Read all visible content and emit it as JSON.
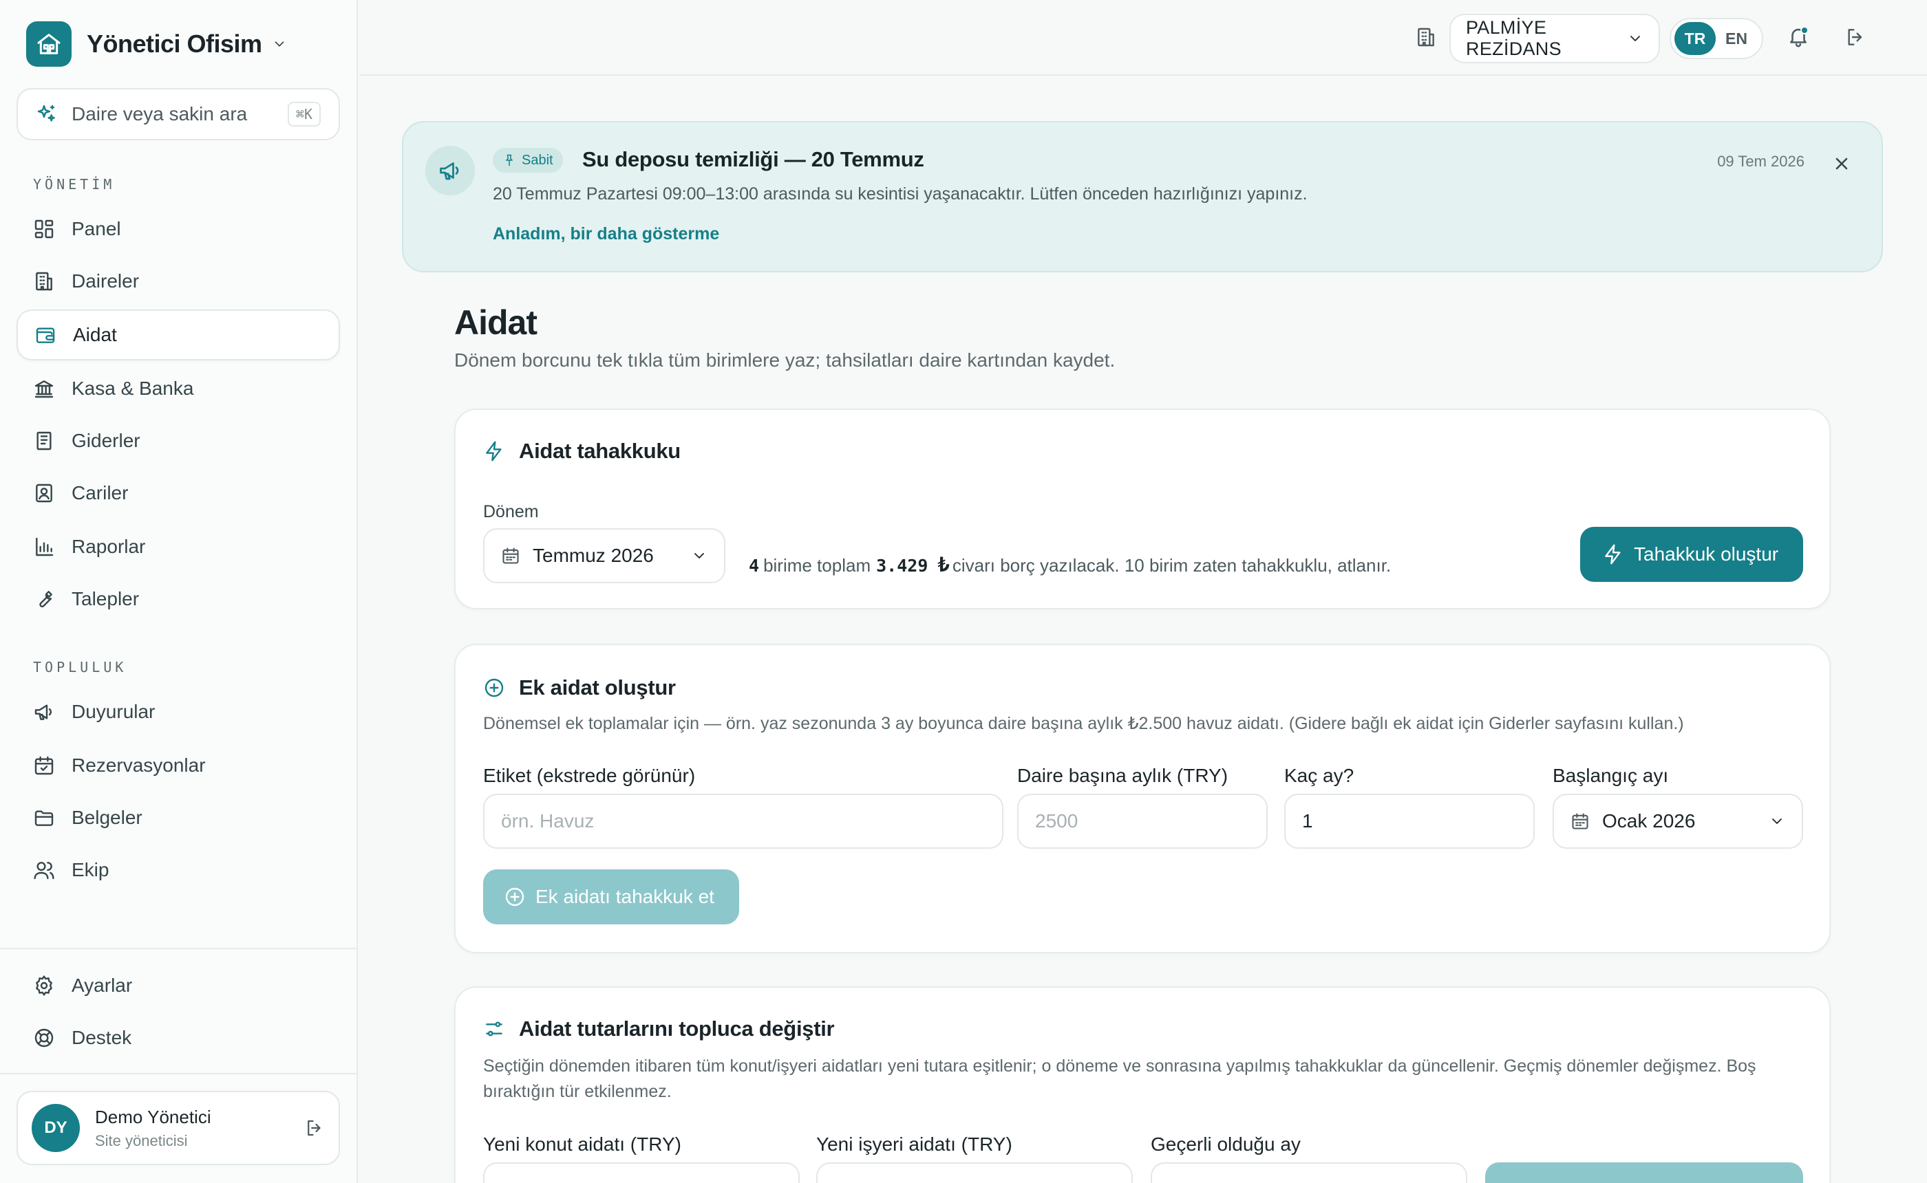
{
  "brand": {
    "name": "Yönetici Ofisim"
  },
  "search": {
    "placeholder": "Daire veya sakin ara",
    "shortcut": "⌘K"
  },
  "sidebar": {
    "group_management": "YÖNETİM",
    "group_community": "TOPLULUK",
    "items": [
      {
        "label": "Panel",
        "icon": "grid-icon"
      },
      {
        "label": "Daireler",
        "icon": "building-icon"
      },
      {
        "label": "Aidat",
        "icon": "wallet-icon",
        "active": true
      },
      {
        "label": "Kasa & Banka",
        "icon": "bank-icon"
      },
      {
        "label": "Giderler",
        "icon": "receipt-icon"
      },
      {
        "label": "Cariler",
        "icon": "contact-icon"
      },
      {
        "label": "Raporlar",
        "icon": "bar-chart-icon"
      },
      {
        "label": "Talepler",
        "icon": "wrench-icon"
      }
    ],
    "community_items": [
      {
        "label": "Duyurular",
        "icon": "megaphone-icon"
      },
      {
        "label": "Rezervasyonlar",
        "icon": "calendar-icon"
      },
      {
        "label": "Belgeler",
        "icon": "folder-icon"
      },
      {
        "label": "Ekip",
        "icon": "users-icon"
      }
    ],
    "bottom_items": [
      {
        "label": "Ayarlar",
        "icon": "gear-icon"
      },
      {
        "label": "Destek",
        "icon": "lifebuoy-icon"
      }
    ]
  },
  "user": {
    "initials": "DY",
    "name": "Demo Yönetici",
    "role": "Site yöneticisi"
  },
  "topbar": {
    "site_name": "PALMİYE REZİDANS",
    "lang_tr": "TR",
    "lang_en": "EN",
    "active_lang": "TR"
  },
  "announcement": {
    "pin_label": "Sabit",
    "title": "Su deposu temizliği — 20 Temmuz",
    "date": "09 Tem 2026",
    "body": "20 Temmuz Pazartesi 09:00–13:00 arasında su kesintisi yaşanacaktır. Lütfen önceden hazırlığınızı yapınız.",
    "dismiss_link": "Anladım, bir daha gösterme"
  },
  "page": {
    "title": "Aidat",
    "subtitle": "Dönem borcunu tek tıkla tüm birimlere yaz; tahsilatları daire kartından kaydet."
  },
  "accrual": {
    "title": "Aidat tahakkuku",
    "period_label": "Dönem",
    "period_value": "Temmuz 2026",
    "summary_count": "4",
    "summary_mid": "birime toplam",
    "summary_amount": "3.429",
    "summary_currency": "₺",
    "summary_rest": "civarı borç yazılacak. 10 birim zaten tahakkuklu, atlanır.",
    "button": "Tahakkuk oluştur"
  },
  "extra": {
    "title": "Ek aidat oluştur",
    "description": "Dönemsel ek toplamalar için — örn. yaz sezonunda 3 ay boyunca daire başına aylık ₺2.500 havuz aidatı. (Gidere bağlı ek aidat için Giderler sayfasını kullan.)",
    "label_field": "Etiket (ekstrede görünür)",
    "label_placeholder": "örn. Havuz",
    "monthly_field": "Daire başına aylık (TRY)",
    "monthly_placeholder": "2500",
    "months_field": "Kaç ay?",
    "months_value": "1",
    "start_field": "Başlangıç ayı",
    "start_value": "Ocak 2026",
    "button": "Ek aidatı tahakkuk et"
  },
  "bulk": {
    "title": "Aidat tutarlarını topluca değiştir",
    "description": "Seçtiğin dönemden itibaren tüm konut/işyeri aidatları yeni tutara eşitlenir; o döneme ve sonrasına yapılmış tahakkuklar da güncellenir. Geçmiş dönemler değişmez. Boş bıraktığın tür etkilenmez.",
    "residential_field": "Yeni konut aidatı (TRY)",
    "commercial_field": "Yeni işyeri aidatı (TRY)",
    "effective_field": "Geçerli olduğu ay"
  },
  "colors": {
    "accent": "#167f89",
    "accent_light": "#e4f2f1",
    "disabled_button": "#8cc7cb"
  }
}
